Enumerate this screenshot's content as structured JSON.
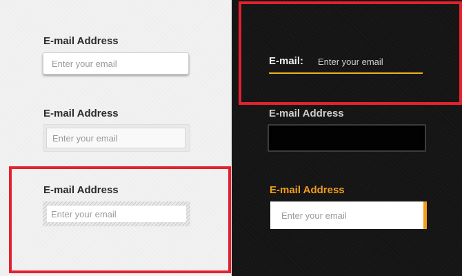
{
  "light_panel": {
    "fields": [
      {
        "label": "E-mail Address",
        "placeholder": "Enter your email"
      },
      {
        "label": "E-mail Address",
        "placeholder": "Enter your email"
      },
      {
        "label": "E-mail Address",
        "placeholder": "Enter your email"
      }
    ]
  },
  "dark_panel": {
    "fields": [
      {
        "label": "E-mail:",
        "placeholder": "Enter your email"
      },
      {
        "label": "E-mail Address",
        "placeholder": ""
      },
      {
        "label": "E-mail Address",
        "placeholder": "Enter your email"
      }
    ]
  },
  "colors": {
    "light_background": "#f2f2f2",
    "dark_background": "#121212",
    "highlight_border": "#e3222d",
    "accent_orange": "#f39c1e",
    "accent_yellow": "#f2b21a"
  }
}
